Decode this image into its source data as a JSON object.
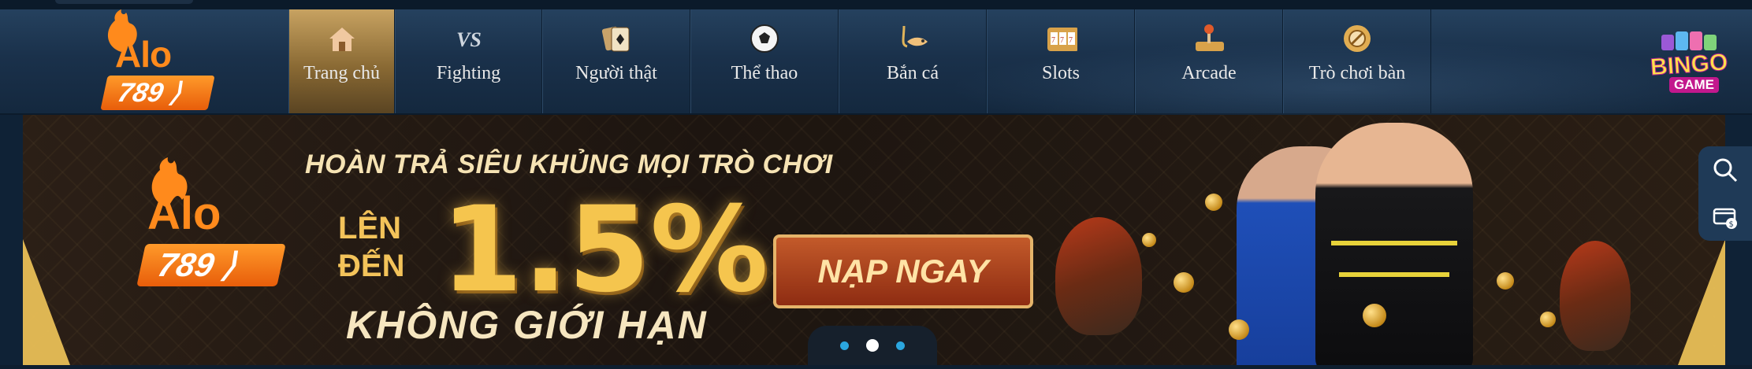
{
  "header": {
    "logo": {
      "brand_top": "Alo",
      "brand_number": "789"
    },
    "nav": [
      {
        "label": "Trang chủ",
        "icon": "home-icon",
        "active": true
      },
      {
        "label": "Fighting",
        "icon": "versus-icon",
        "active": false
      },
      {
        "label": "Người thật",
        "icon": "playing-cards-icon",
        "active": false
      },
      {
        "label": "Thể thao",
        "icon": "soccer-ball-icon",
        "active": false
      },
      {
        "label": "Bắn cá",
        "icon": "fish-hook-icon",
        "active": false
      },
      {
        "label": "Slots",
        "icon": "slot-machine-icon",
        "active": false
      },
      {
        "label": "Arcade",
        "icon": "joystick-icon",
        "active": false
      },
      {
        "label": "Trò chơi bàn",
        "icon": "poker-chip-icon",
        "active": false
      }
    ],
    "bingo": {
      "title": "BINGO",
      "subtitle": "GAME"
    }
  },
  "banner": {
    "logo": {
      "brand_top": "Alo",
      "brand_number": "789"
    },
    "headline": "HOÀN TRẢ SIÊU KHỦNG MỌI TRÒ CHƠI",
    "len": "LÊN",
    "den": "ĐẾN",
    "percent": "1.5%",
    "nolimit": "KHÔNG GIỚI HẠN",
    "cta": "NẠP NGAY",
    "slides_total": 3,
    "slide_active": 2
  },
  "side_widget": {
    "items": [
      "search-icon",
      "wallet-icon"
    ]
  },
  "colors": {
    "header_bg": "#1a314b",
    "active_tab": "#c7a261",
    "brand_orange": "#ff8a1c",
    "gold": "#f5c54e",
    "dot_blue": "#2ba6df"
  }
}
